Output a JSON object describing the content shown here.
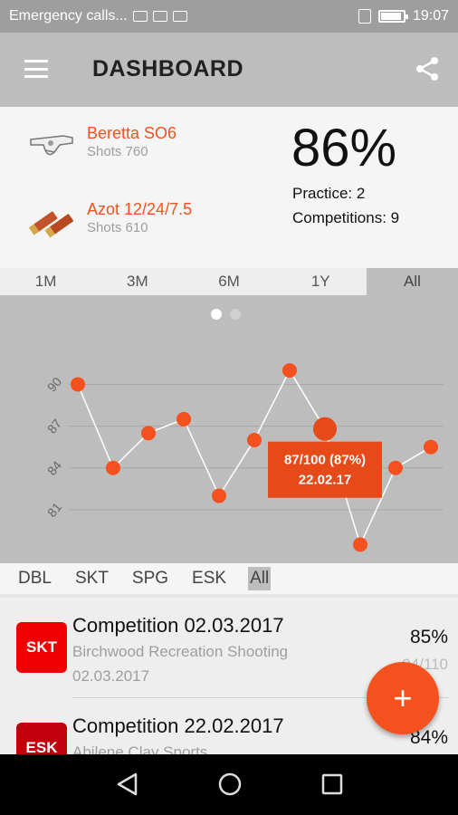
{
  "status_bar": {
    "notification": "Emergency calls...",
    "time": "19:07"
  },
  "app_bar": {
    "title": "DASHBOARD",
    "menu_icon": "hamburger-menu-icon",
    "share_icon": "share-icon"
  },
  "summary": {
    "gun": {
      "name": "Beretta SO6",
      "shots": "Shots 760",
      "icon": "shotgun-icon"
    },
    "ammo": {
      "name": "Azot 12/24/7.5",
      "shots": "Shots 610",
      "icon": "shells-icon"
    },
    "overall_pct": "86%",
    "practice": "Practice: 2",
    "competitions": "Competitions: 9"
  },
  "period_tabs": [
    {
      "label": "1M",
      "active": false
    },
    {
      "label": "3M",
      "active": false
    },
    {
      "label": "6M",
      "active": false
    },
    {
      "label": "1Y",
      "active": false
    },
    {
      "label": "All",
      "active": true
    }
  ],
  "chart_data": {
    "type": "line",
    "y_ticks": [
      "81",
      "84",
      "87",
      "90"
    ],
    "ylim": [
      79.5,
      92.5
    ],
    "values": [
      90,
      84,
      86.5,
      87.5,
      82,
      86,
      91,
      86.8,
      78.5,
      84,
      85.5
    ],
    "highlight_index": 7,
    "tooltip": {
      "line1": "87/100 (87%)",
      "line2": "22.02.17"
    },
    "grid": true,
    "page_dots": 2,
    "active_page": 0
  },
  "discipline_filter": [
    {
      "label": "DBL",
      "active": false
    },
    {
      "label": "SKT",
      "active": false
    },
    {
      "label": "SPG",
      "active": false
    },
    {
      "label": "ESK",
      "active": false
    },
    {
      "label": "All",
      "active": true
    }
  ],
  "events": [
    {
      "badge": "SKT",
      "badge_color": "#f00000",
      "title": "Competition 02.03.2017",
      "location": "Birchwood Recreation Shooting",
      "date": "02.03.2017",
      "percent": "85%",
      "score": "94/110"
    },
    {
      "badge": "ESK",
      "badge_color": "#c0000a",
      "title": "Competition 22.02.2017",
      "location": "Abilene Clay Sports",
      "date": "",
      "percent": "84%",
      "score": ""
    }
  ],
  "fab": {
    "label": "+",
    "icon": "add-icon"
  },
  "colors": {
    "accent": "#f4511e",
    "tooltip": "#e64a19"
  }
}
